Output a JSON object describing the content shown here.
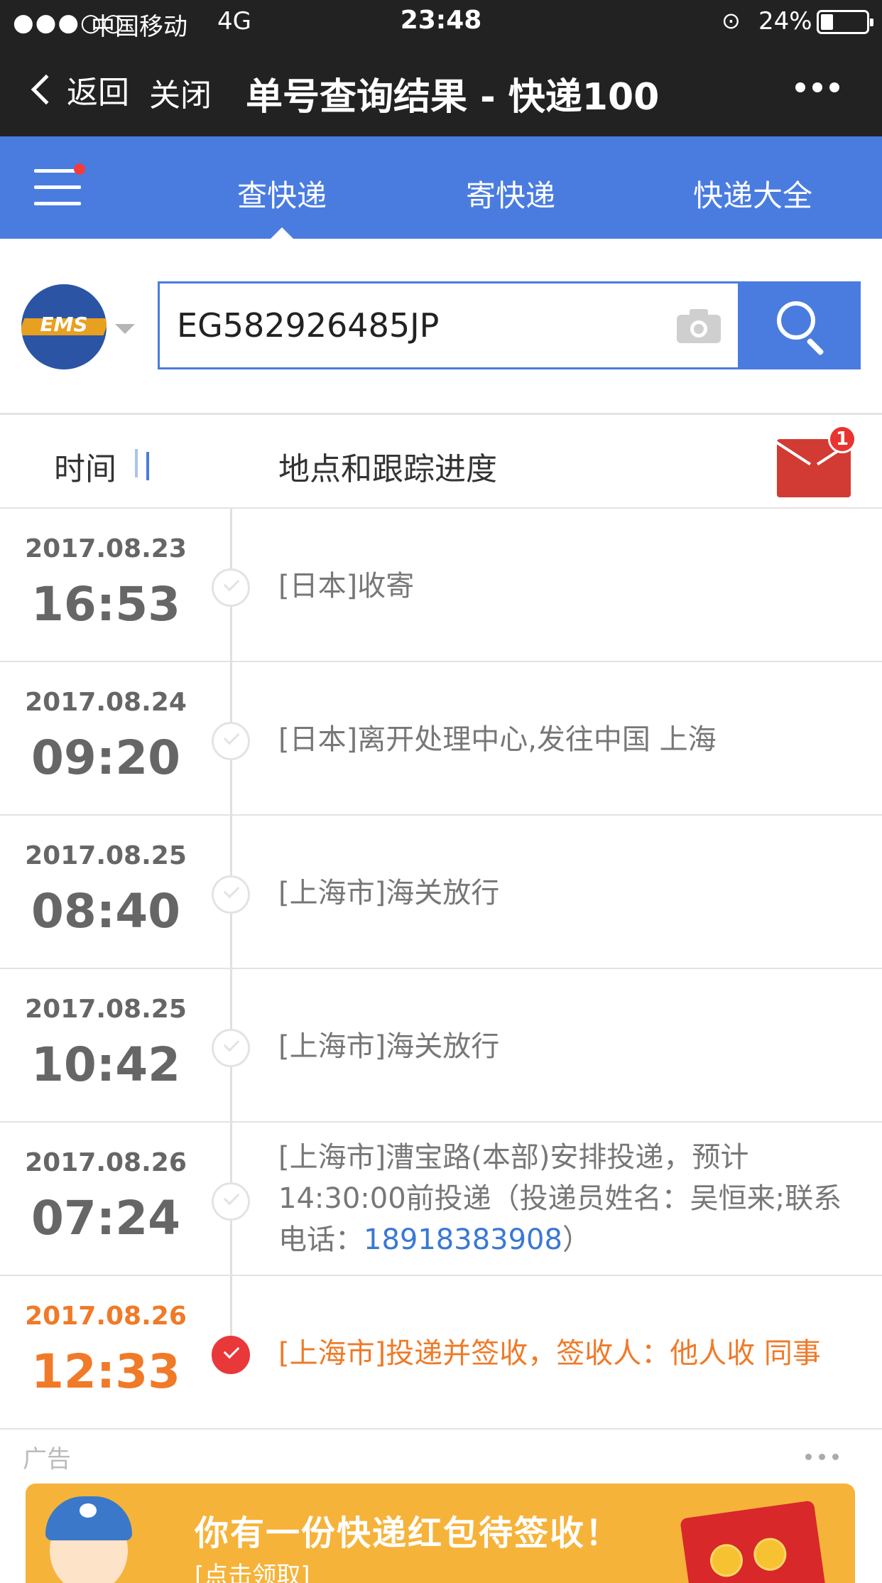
{
  "status_bar": {
    "signal": "●●●○○",
    "carrier": "中国移动",
    "network": "4G",
    "time": "23:48",
    "battery": "24%"
  },
  "nav": {
    "back_label": "返回",
    "close_label": "关闭",
    "title": "单号查询结果 - 快递100"
  },
  "tabs": [
    {
      "label": "查快递",
      "active": true
    },
    {
      "label": "寄快递",
      "active": false
    },
    {
      "label": "快递大全",
      "active": false
    }
  ],
  "search": {
    "courier_logo_text": "EMS",
    "tracking_number": "EG582926485JP"
  },
  "table_header": {
    "time_label": "时间",
    "location_label": "地点和跟踪进度",
    "mail_badge": "1"
  },
  "events": [
    {
      "date": "2017.08.23",
      "time": "16:53",
      "desc": "[日本]收寄"
    },
    {
      "date": "2017.08.24",
      "time": "09:20",
      "desc": "[日本]离开处理中心,发往中国 上海"
    },
    {
      "date": "2017.08.25",
      "time": "08:40",
      "desc": "[上海市]海关放行"
    },
    {
      "date": "2017.08.25",
      "time": "10:42",
      "desc": "[上海市]海关放行"
    },
    {
      "date": "2017.08.26",
      "time": "07:24",
      "desc_before": "[上海市]漕宝路(本部)安排投递，预计14:30:00前投递（投递员姓名：吴恒来;联系电话：",
      "phone": "18918383908",
      "desc_after": "）"
    },
    {
      "date": "2017.08.26",
      "time": "12:33",
      "desc": "[上海市]投递并签收，签收人：他人收 同事"
    }
  ],
  "ad": {
    "label": "广告",
    "message": "你有一份快递红包待签收！",
    "sub": "[点击领取]"
  },
  "colors": {
    "accent": "#4a7ce0",
    "delivered": "#f07a28",
    "phone_link": "#3a78d4"
  }
}
